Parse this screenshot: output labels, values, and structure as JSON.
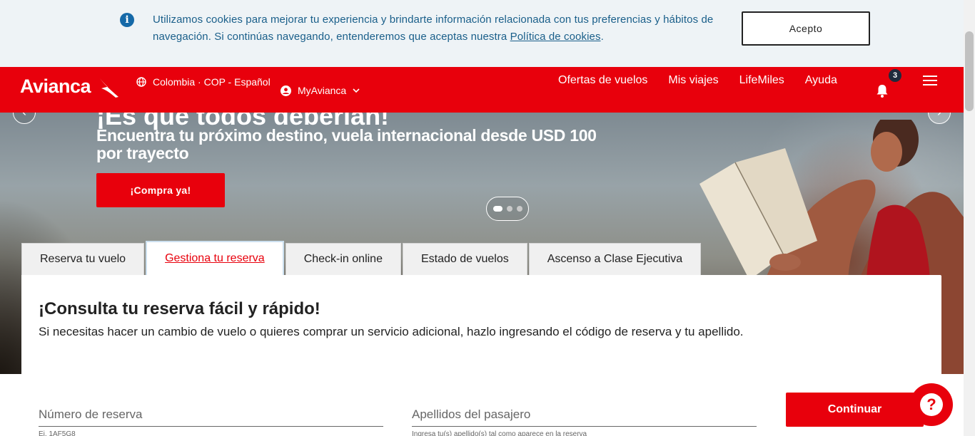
{
  "cookie_banner": {
    "text": "Utilizamos cookies para mejorar tu experiencia y brindarte información relacionada con tus preferencias y hábitos de navegación. Si continúas navegando, entenderemos que aceptas nuestra ",
    "link": "Política de cookies",
    "end": ".",
    "accept_label": "Acepto"
  },
  "header": {
    "logo": "Avianca",
    "region": "Colombia · COP - Español",
    "account": "MyAvianca",
    "nav": [
      "Ofertas de vuelos",
      "Mis viajes",
      "LifeMiles",
      "Ayuda"
    ],
    "notifications_count": "3"
  },
  "hero": {
    "title_partial": "¡Es que todos deberían!",
    "subtitle": "Encuentra tu próximo destino, vuela internacional desde USD 100 por trayecto",
    "cta": "¡Compra ya!",
    "slides": 3,
    "active_slide": 1
  },
  "tabs": [
    {
      "label": "Reserva tu vuelo",
      "active": false
    },
    {
      "label": "Gestiona tu reserva",
      "active": true
    },
    {
      "label": "Check-in online",
      "active": false
    },
    {
      "label": "Estado de vuelos",
      "active": false
    },
    {
      "label": "Ascenso a Clase Ejecutiva",
      "active": false
    }
  ],
  "booking": {
    "title": "¡Consulta tu reserva fácil y rápido!",
    "description": "Si necesitas hacer un cambio de vuelo o quieres comprar un servicio adicional, hazlo ingresando el código de reserva y tu apellido.",
    "reservation_label": "Número de reserva",
    "reservation_hint": "Ej. 1AF5G8",
    "lastname_label": "Apellidos del pasajero",
    "lastname_hint": "Ingresa tu(s) apellido(s) tal como aparece en la reserva",
    "continue_label": "Continuar"
  },
  "colors": {
    "brand_red": "#e8000c",
    "cookie_text": "#1a5f8a"
  }
}
